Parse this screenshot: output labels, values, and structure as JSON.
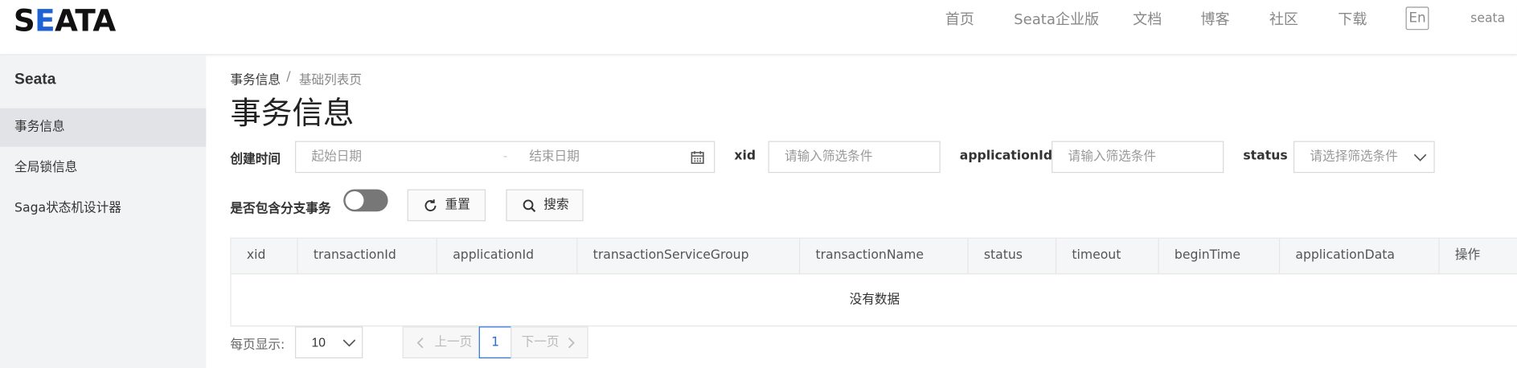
{
  "header": {
    "logo_text": "SEATA",
    "nav": [
      {
        "label": "首页"
      },
      {
        "label": "Seata企业版"
      },
      {
        "label": "文档"
      },
      {
        "label": "博客"
      },
      {
        "label": "社区"
      },
      {
        "label": "下载"
      }
    ],
    "lang_label": "En",
    "user_label": "seata"
  },
  "sidebar": {
    "title": "Seata",
    "items": [
      {
        "label": "事务信息",
        "active": true
      },
      {
        "label": "全局锁信息",
        "active": false
      },
      {
        "label": "Saga状态机设计器",
        "active": false
      }
    ]
  },
  "breadcrumb": {
    "items": [
      {
        "label": "事务信息"
      },
      {
        "label": "基础列表页"
      }
    ],
    "separator": "/"
  },
  "page_title": "事务信息",
  "filters": {
    "create_time": {
      "label": "创建时间",
      "start_placeholder": "起始日期",
      "separator": "-",
      "end_placeholder": "结束日期"
    },
    "xid": {
      "label": "xid",
      "placeholder": "请输入筛选条件"
    },
    "application_id": {
      "label": "applicationId",
      "placeholder": "请输入筛选条件"
    },
    "status": {
      "label": "status",
      "placeholder": "请选择筛选条件"
    },
    "include_branch": {
      "label": "是否包含分支事务",
      "on": false
    },
    "reset_label": "重置",
    "search_label": "搜索"
  },
  "table": {
    "columns": [
      {
        "label": "xid"
      },
      {
        "label": "transactionId"
      },
      {
        "label": "applicationId"
      },
      {
        "label": "transactionServiceGroup"
      },
      {
        "label": "transactionName"
      },
      {
        "label": "status"
      },
      {
        "label": "timeout"
      },
      {
        "label": "beginTime"
      },
      {
        "label": "applicationData"
      },
      {
        "label": "操作"
      }
    ],
    "rows": [],
    "empty_text": "没有数据"
  },
  "pagination": {
    "page_size_label": "每页显示:",
    "page_size": "10",
    "prev_label": "上一页",
    "current_page": "1",
    "next_label": "下一页"
  },
  "colors": {
    "logo_accent": "#1e63d6",
    "active_page": "#2a6ed8",
    "sidebar_bg": "#f2f3f5",
    "sidebar_active": "#e2e3e6"
  }
}
